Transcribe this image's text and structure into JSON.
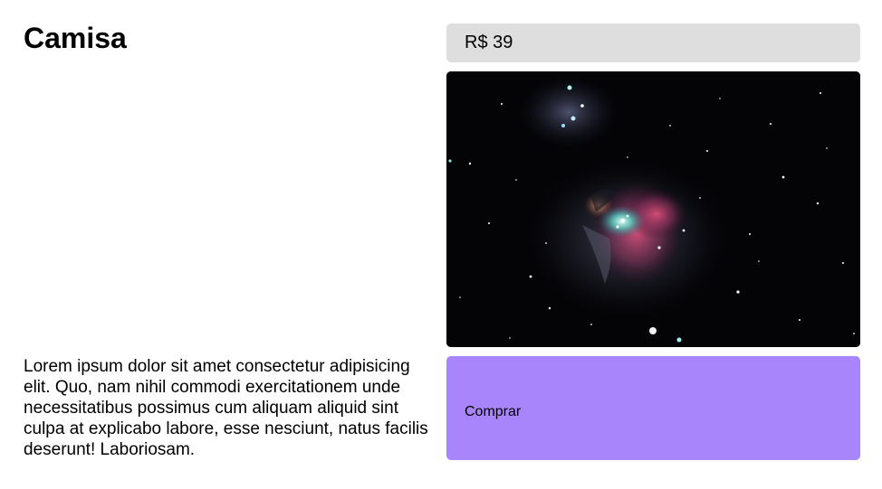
{
  "product": {
    "title": "Camisa",
    "price": "R$ 39",
    "description": "Lorem ipsum dolor sit amet consectetur adipisicing elit. Quo, nam nihil commodi exercitationem unde necessitatibus possimus cum aliquam aliquid sint culpa at explicabo labore, esse nesciunt, natus facilis deserunt! Laboriosam.",
    "buy_label": "Comprar",
    "image_subject": "orion-nebula-photo"
  },
  "colors": {
    "price_background": "#dedede",
    "buy_background": "#a985fc",
    "image_background": "#040407"
  }
}
